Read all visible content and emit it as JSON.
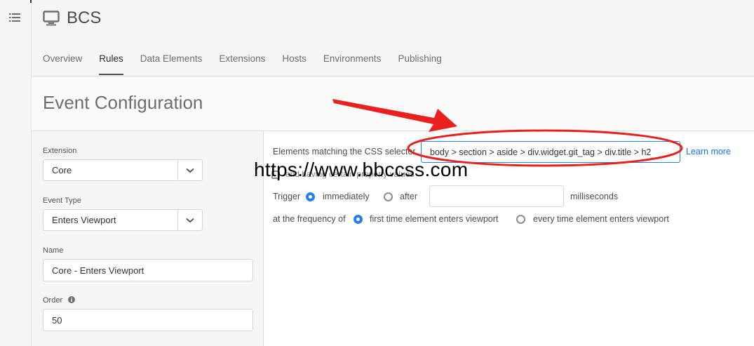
{
  "app": {
    "title": "BCS"
  },
  "tabs": [
    {
      "label": "Overview"
    },
    {
      "label": "Rules"
    },
    {
      "label": "Data Elements"
    },
    {
      "label": "Extensions"
    },
    {
      "label": "Hosts"
    },
    {
      "label": "Environments"
    },
    {
      "label": "Publishing"
    }
  ],
  "active_tab": "Rules",
  "section": {
    "title": "Event Configuration"
  },
  "left": {
    "extension_label": "Extension",
    "extension_value": "Core",
    "event_type_label": "Event Type",
    "event_type_value": "Enters Viewport",
    "name_label": "Name",
    "name_value": "Core - Enters Viewport",
    "order_label": "Order",
    "order_value": "50"
  },
  "right": {
    "css_label": "Elements matching the CSS selector",
    "css_value": "body > section > aside > div.widget.git_tag > div.title > h2",
    "learn_more": "Learn more",
    "property_checkbox_label": "and having certain property values",
    "trigger_label": "Trigger",
    "trigger_immediately": "immediately",
    "trigger_after": "after",
    "milliseconds": "milliseconds",
    "frequency_label": "at the frequency of",
    "frequency_first": "first time element enters viewport",
    "frequency_every": "every time element enters viewport"
  },
  "watermark": "https://www.bbccss.com",
  "colors": {
    "accent": "#2680eb",
    "annotation": "#e8201e",
    "link": "#1473e6"
  }
}
